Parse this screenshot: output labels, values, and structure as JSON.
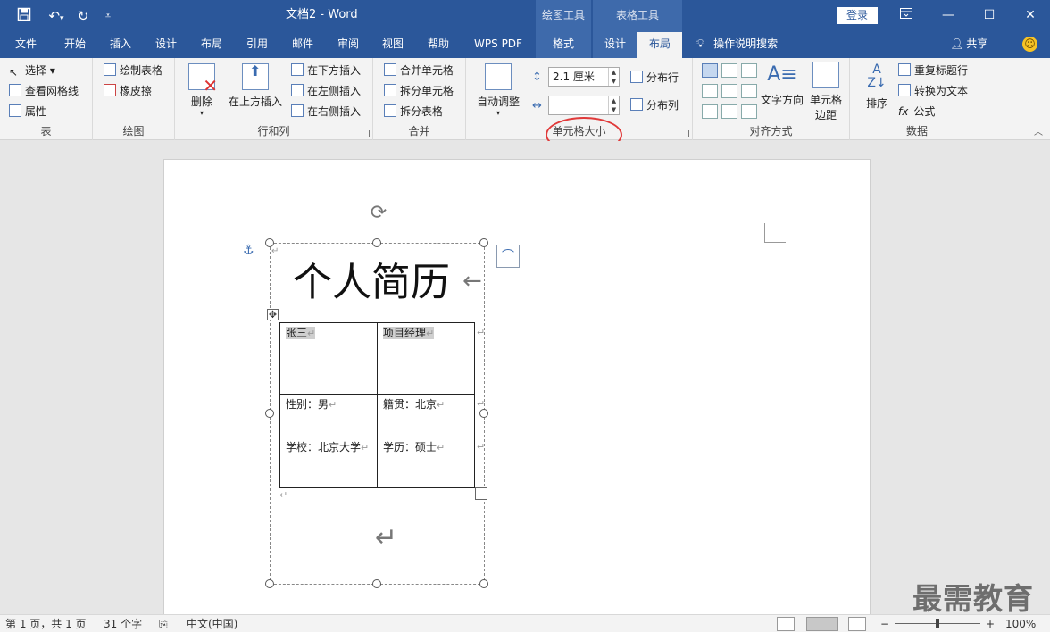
{
  "title_bar": {
    "document_title": "文档2  -  Word",
    "context_draw_tools": "绘图工具",
    "context_table_tools": "表格工具",
    "login": "登录",
    "icons": [
      "save-icon",
      "undo-icon",
      "redo-icon",
      "customize-qat-icon",
      "ribbon-display-icon",
      "minimize-icon",
      "maximize-icon",
      "close-icon"
    ]
  },
  "menu": {
    "tabs": [
      "文件",
      "开始",
      "插入",
      "设计",
      "布局",
      "引用",
      "邮件",
      "审阅",
      "视图",
      "帮助",
      "WPS PDF",
      "格式",
      "设计",
      "布局"
    ],
    "active_tab": "布局",
    "tell_me": "操作说明搜索",
    "share": "共享"
  },
  "ribbon": {
    "table_group": {
      "label": "表",
      "select": "选择",
      "view_gridlines": "查看网格线",
      "properties": "属性"
    },
    "draw_group": {
      "label": "绘图",
      "draw_table": "绘制表格",
      "eraser": "橡皮擦"
    },
    "rows_cols_group": {
      "label": "行和列",
      "delete": "删除",
      "insert_above": "在上方插入",
      "insert_below": "在下方插入",
      "insert_left": "在左侧插入",
      "insert_right": "在右侧插入"
    },
    "merge_group": {
      "label": "合并",
      "merge_cells": "合并单元格",
      "split_cells": "拆分单元格",
      "split_table": "拆分表格"
    },
    "cell_size_group": {
      "label": "单元格大小",
      "autofit": "自动调整",
      "height_value": "2.1 厘米",
      "width_value": "",
      "distribute_rows": "分布行",
      "distribute_cols": "分布列"
    },
    "align_group": {
      "label": "对齐方式",
      "text_direction": "文字方向",
      "cell_margins_line1": "单元格",
      "cell_margins_line2": "边距"
    },
    "data_group": {
      "label": "数据",
      "sort": "排序",
      "repeat_header": "重复标题行",
      "convert_to_text": "转换为文本",
      "formula": "公式"
    }
  },
  "document": {
    "heading": "个人简历",
    "table": {
      "rows": [
        [
          "张三",
          "项目经理"
        ],
        [
          "性别：男",
          "籍贯：北京"
        ],
        [
          "学校：北京大学",
          "学历：硕士"
        ]
      ]
    },
    "watermark": "最需教育"
  },
  "status_bar": {
    "page": "第 1 页，共 1 页",
    "words": "31 个字",
    "language": "中文(中国)",
    "zoom": "100%",
    "zoom_level": 1.0
  }
}
